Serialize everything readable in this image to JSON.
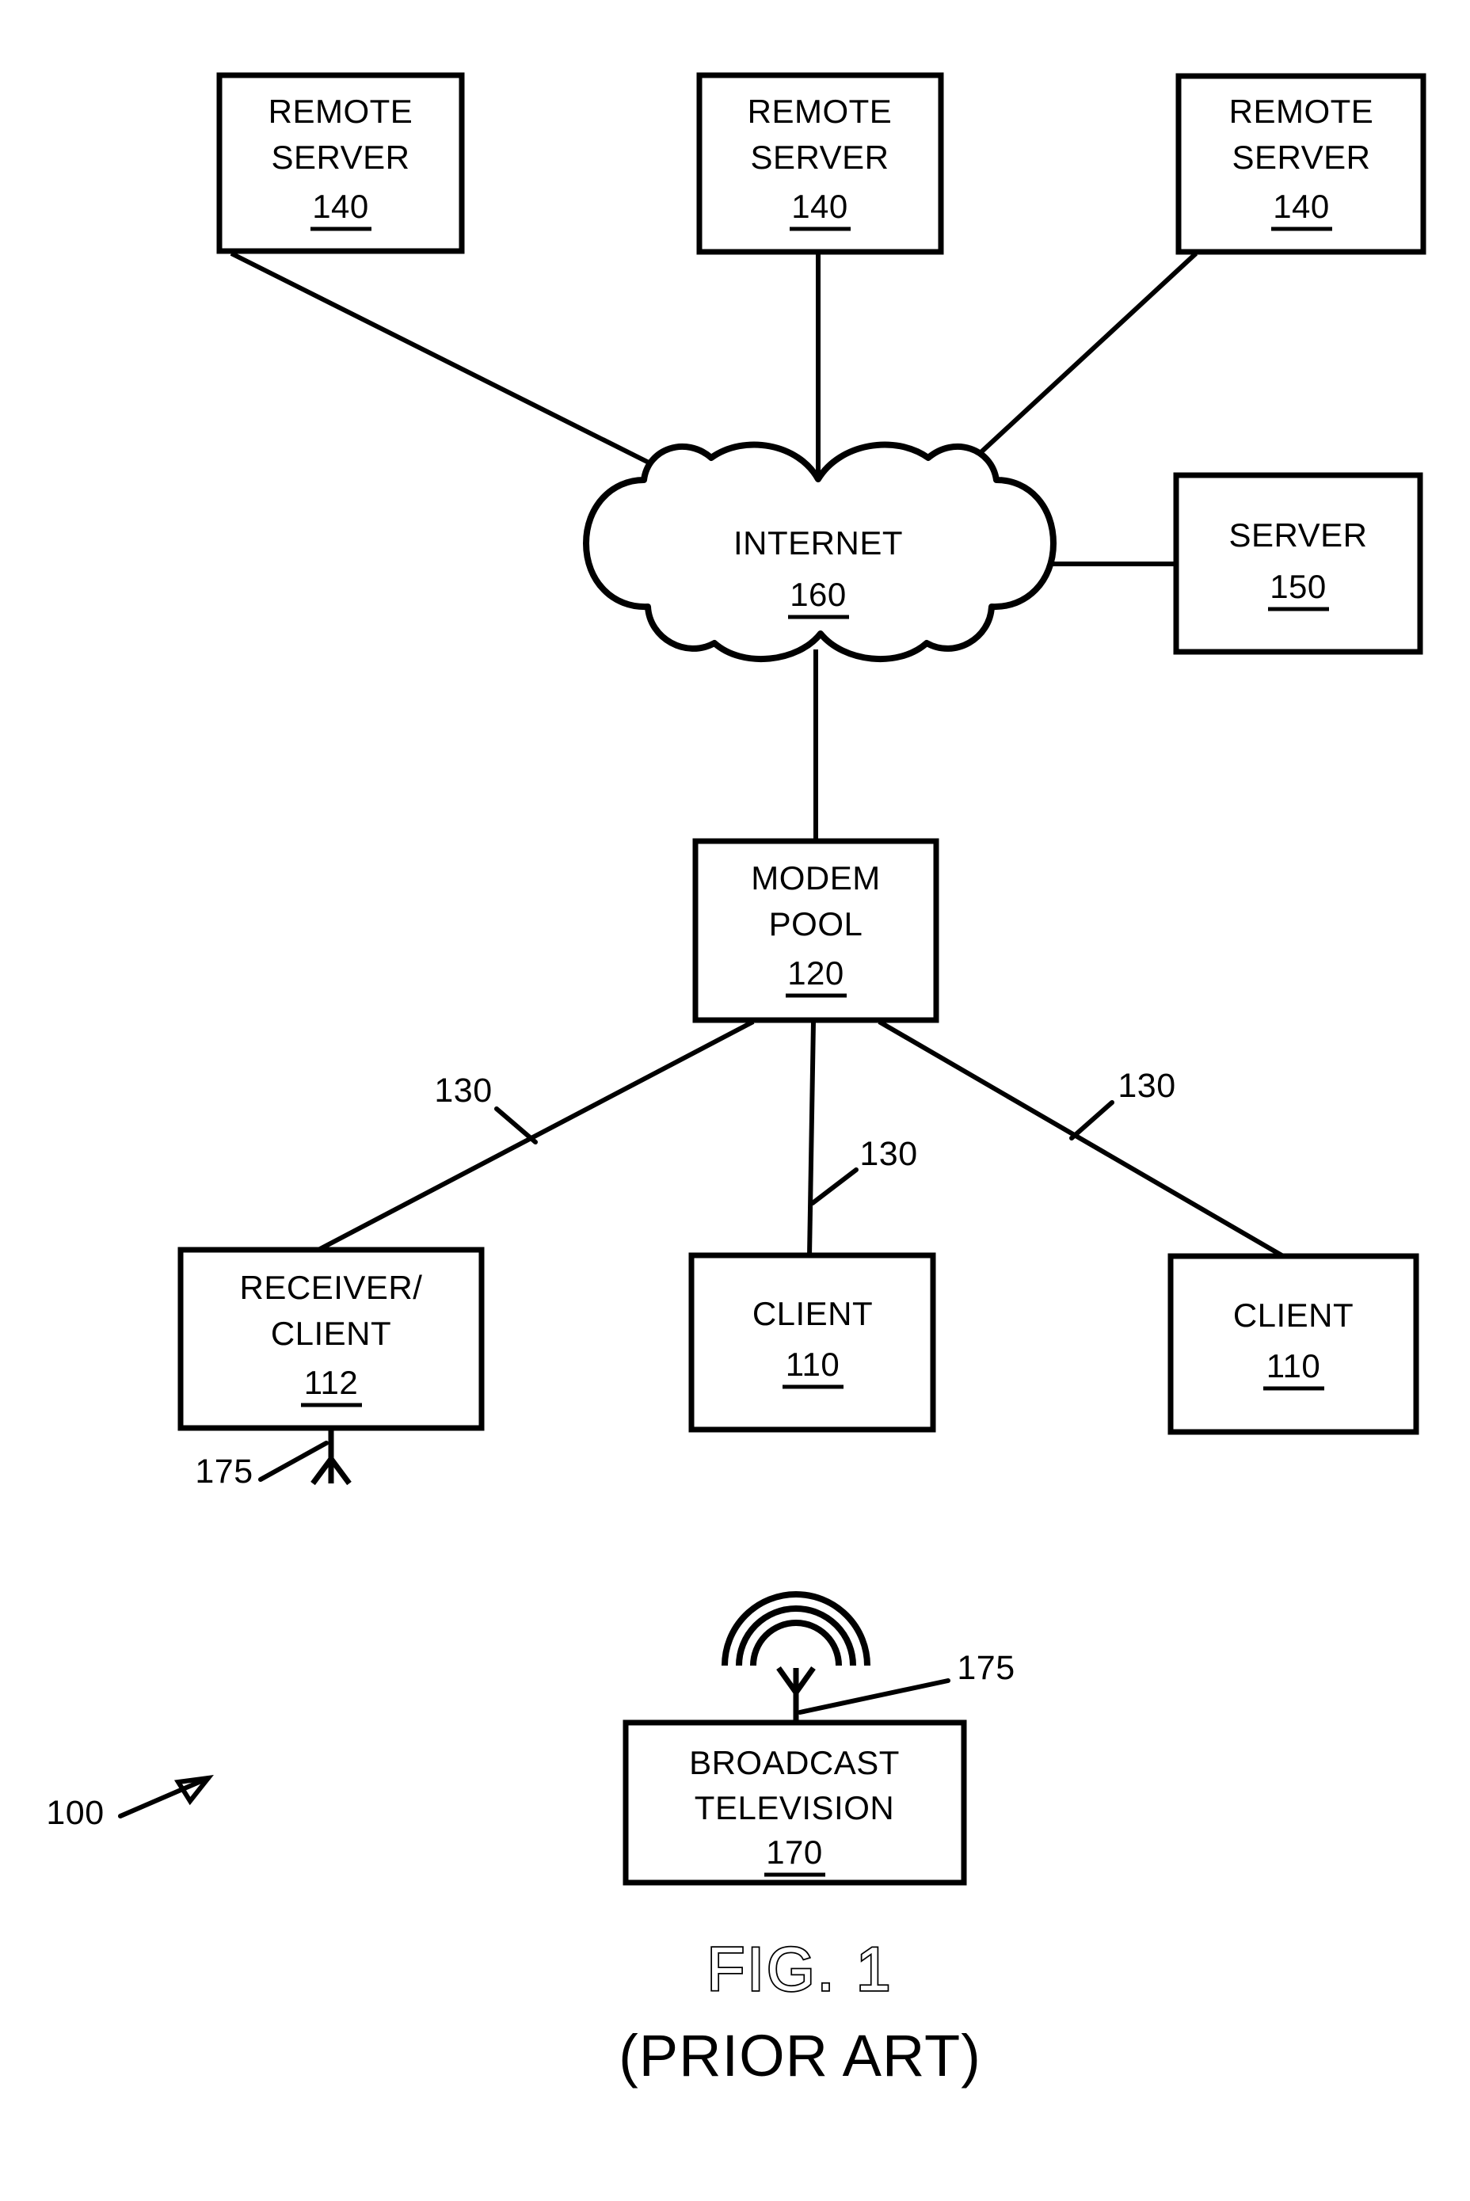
{
  "figure": {
    "title": "FIG. 1",
    "subtitle": "(PRIOR ART)",
    "system_reference": "100"
  },
  "nodes": {
    "remote_server_left": {
      "line1": "REMOTE",
      "line2": "SERVER",
      "ref": "140"
    },
    "remote_server_center": {
      "line1": "REMOTE",
      "line2": "SERVER",
      "ref": "140"
    },
    "remote_server_right": {
      "line1": "REMOTE",
      "line2": "SERVER",
      "ref": "140"
    },
    "internet_cloud": {
      "line1": "INTERNET",
      "ref": "160"
    },
    "server": {
      "line1": "SERVER",
      "ref": "150"
    },
    "modem_pool": {
      "line1": "MODEM",
      "line2": "POOL",
      "ref": "120"
    },
    "receiver_client": {
      "line1": "RECEIVER/",
      "line2": "CLIENT",
      "ref": "112"
    },
    "client_center": {
      "line1": "CLIENT",
      "ref": "110"
    },
    "client_right": {
      "line1": "CLIENT",
      "ref": "110"
    },
    "broadcast_television": {
      "line1": "BROADCAST",
      "line2": "TELEVISION",
      "ref": "170"
    }
  },
  "link_labels": {
    "modem_to_receiver": "130",
    "modem_to_client_center": "130",
    "modem_to_client_right": "130",
    "receiver_antenna": "175",
    "broadcast_antenna": "175"
  },
  "colors": {
    "ink": "#000000",
    "paper": "#ffffff"
  }
}
